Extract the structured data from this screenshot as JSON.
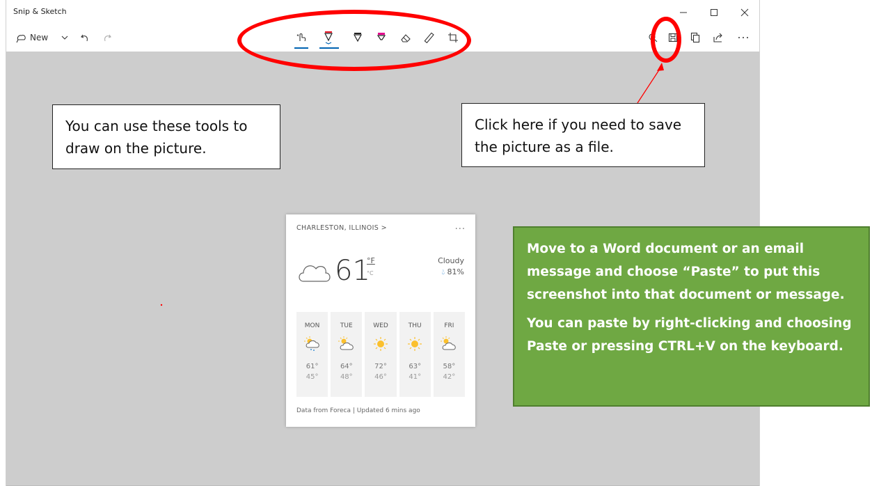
{
  "app": {
    "title": "Snip & Sketch",
    "new_label": "New"
  },
  "callouts": {
    "tools": "You can use these tools to draw on the picture.",
    "save": "Click here if you need to save the picture as a file."
  },
  "weather": {
    "location": "CHARLESTON, ILLINOIS  >",
    "more": "...",
    "temperature": "61",
    "unit_f": "°F",
    "unit_c": "°C",
    "condition": "Cloudy",
    "humidity": "81%",
    "days": [
      {
        "name": "MON",
        "hi": "61°",
        "lo": "45°",
        "icon": "sun-cloud-rain-icon"
      },
      {
        "name": "TUE",
        "hi": "64°",
        "lo": "48°",
        "icon": "partly-sunny-icon"
      },
      {
        "name": "WED",
        "hi": "72°",
        "lo": "46°",
        "icon": "sun-icon"
      },
      {
        "name": "THU",
        "hi": "63°",
        "lo": "41°",
        "icon": "sun-icon"
      },
      {
        "name": "FRI",
        "hi": "58°",
        "lo": "42°",
        "icon": "partly-sunny-icon"
      }
    ],
    "footer": "Data from Foreca | Updated 6 mins ago"
  },
  "green_box": {
    "paragraph1": "Move to a Word document or an email message and choose “Paste” to put this screenshot into that document or message.",
    "paragraph2": "You can paste by right-clicking and choosing Paste or pressing CTRL+V on the keyboard."
  },
  "colors": {
    "annotation_red": "#ff0000",
    "green_box": "#6fa843",
    "canvas_gray": "#cdcdcd",
    "accent_blue": "#0063b1"
  }
}
